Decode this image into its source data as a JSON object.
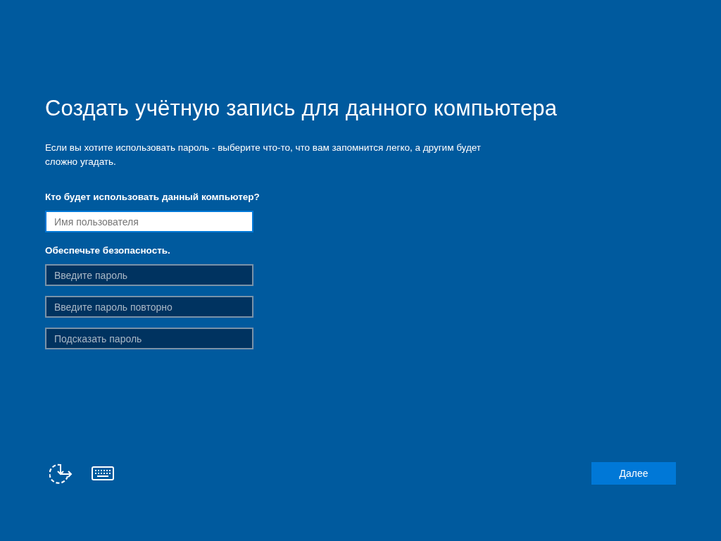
{
  "title": "Создать учётную запись для данного компьютера",
  "description": "Если вы хотите использовать пароль - выберите что-то, что вам запомнится легко, а другим будет сложно угадать.",
  "sections": [
    {
      "label": "Кто будет использовать данный компьютер?",
      "fields": [
        {
          "placeholder": "Имя пользователя",
          "focused": true
        }
      ]
    },
    {
      "label": "Обеспечьте безопасность.",
      "fields": [
        {
          "placeholder": "Введите пароль",
          "focused": false
        },
        {
          "placeholder": "Введите пароль повторно",
          "focused": false
        },
        {
          "placeholder": "Подсказать пароль",
          "focused": false
        }
      ]
    }
  ],
  "footer": {
    "tools": [
      {
        "kind": "accessibility"
      },
      {
        "kind": "keyboard"
      }
    ],
    "next_button": "Далее"
  }
}
